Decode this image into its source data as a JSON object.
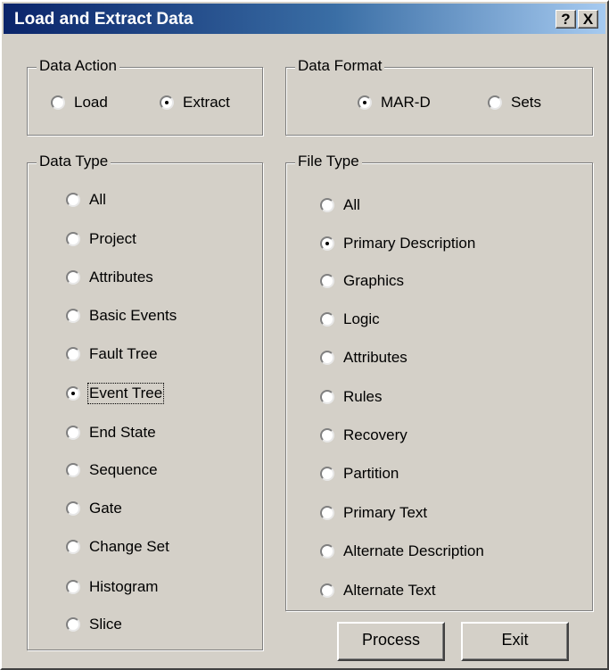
{
  "window": {
    "title": "Load and Extract Data",
    "help_button": "?",
    "close_button": "X"
  },
  "data_action": {
    "label": "Data Action",
    "options": [
      "Load",
      "Extract"
    ],
    "selected": "Extract"
  },
  "data_format": {
    "label": "Data Format",
    "options": [
      "MAR-D",
      "Sets"
    ],
    "selected": "MAR-D"
  },
  "data_type": {
    "label": "Data Type",
    "options": [
      "All",
      "Project",
      "Attributes",
      "Basic Events",
      "Fault Tree",
      "Event Tree",
      "End State",
      "Sequence",
      "Gate",
      "Change Set",
      "Histogram",
      "Slice"
    ],
    "selected": "Event Tree"
  },
  "file_type": {
    "label": "File Type",
    "options": [
      "All",
      "Primary Description",
      "Graphics",
      "Logic",
      "Attributes",
      "Rules",
      "Recovery",
      "Partition",
      "Primary Text",
      "Alternate Description",
      "Alternate Text"
    ],
    "selected": "Primary Description"
  },
  "buttons": {
    "process": "Process",
    "exit": "Exit"
  }
}
